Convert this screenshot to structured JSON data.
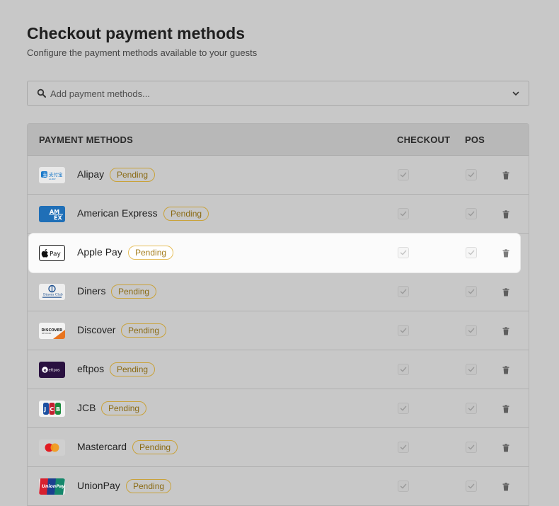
{
  "header": {
    "title": "Checkout payment methods",
    "subtitle": "Configure the payment methods available to your guests"
  },
  "search": {
    "placeholder": "Add payment methods...",
    "icon": "search-icon",
    "dropdown_icon": "chevron-down-icon"
  },
  "table": {
    "columns": {
      "methods": "PAYMENT METHODS",
      "checkout": "CHECKOUT",
      "pos": "POS"
    },
    "rows": [
      {
        "name": "Alipay",
        "status": "Pending",
        "checkout": true,
        "pos": true,
        "logo": "alipay-logo",
        "highlighted": false
      },
      {
        "name": "American Express",
        "status": "Pending",
        "checkout": true,
        "pos": true,
        "logo": "amex-logo",
        "highlighted": false
      },
      {
        "name": "Apple Pay",
        "status": "Pending",
        "checkout": true,
        "pos": true,
        "logo": "apple-pay-logo",
        "highlighted": true
      },
      {
        "name": "Diners",
        "status": "Pending",
        "checkout": true,
        "pos": true,
        "logo": "diners-club-logo",
        "highlighted": false
      },
      {
        "name": "Discover",
        "status": "Pending",
        "checkout": true,
        "pos": true,
        "logo": "discover-logo",
        "highlighted": false
      },
      {
        "name": "eftpos",
        "status": "Pending",
        "checkout": true,
        "pos": true,
        "logo": "eftpos-logo",
        "highlighted": false
      },
      {
        "name": "JCB",
        "status": "Pending",
        "checkout": true,
        "pos": true,
        "logo": "jcb-logo",
        "highlighted": false
      },
      {
        "name": "Mastercard",
        "status": "Pending",
        "checkout": true,
        "pos": true,
        "logo": "mastercard-logo",
        "highlighted": false
      },
      {
        "name": "UnionPay",
        "status": "Pending",
        "checkout": true,
        "pos": true,
        "logo": "unionpay-logo",
        "highlighted": false
      }
    ]
  },
  "colors": {
    "page_background": "#c8c8c8",
    "header_background": "#b8b8b8",
    "pending_badge_border": "#c9a23a",
    "pending_badge_text": "#8a6a14",
    "highlight_row": "#fbfbfb"
  }
}
